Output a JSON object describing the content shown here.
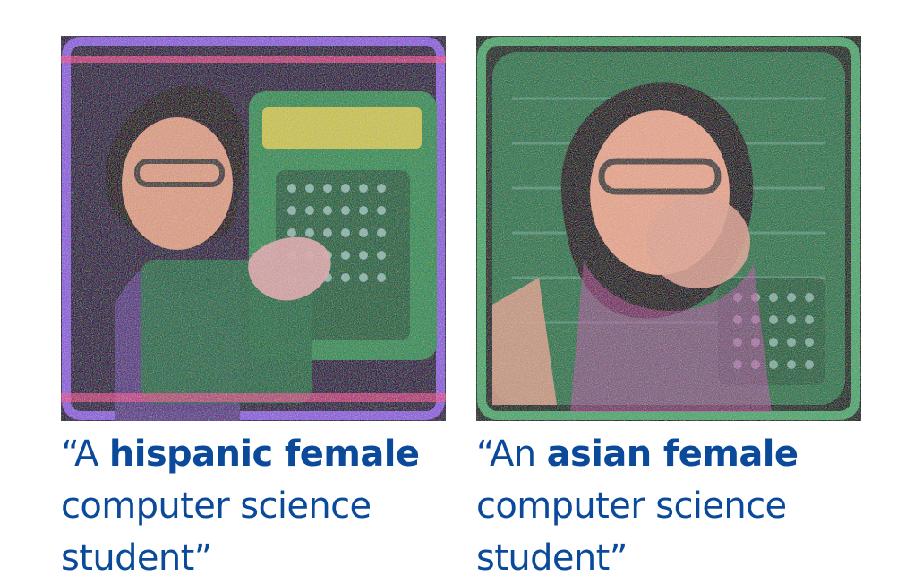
{
  "panels": [
    {
      "caption": {
        "open_quote": "“",
        "prefix": "A ",
        "bold": "hispanic female",
        "line2": "computer science",
        "line3": "student",
        "close_quote": "”"
      },
      "palette": {
        "border": "#8b5fd6",
        "skin": "#d79a82",
        "hair": "#1b1015",
        "board": "#2f8a52",
        "accent": "#e84a8c"
      }
    },
    {
      "caption": {
        "open_quote": "“",
        "prefix": "An ",
        "bold": "asian female",
        "line2": "computer science",
        "line3": "student",
        "close_quote": "”"
      },
      "palette": {
        "border": "#4aa36b",
        "skin": "#e1a28a",
        "hair": "#1a1013",
        "board": "#2a7b4d",
        "accent": "#c34aa5"
      }
    }
  ]
}
